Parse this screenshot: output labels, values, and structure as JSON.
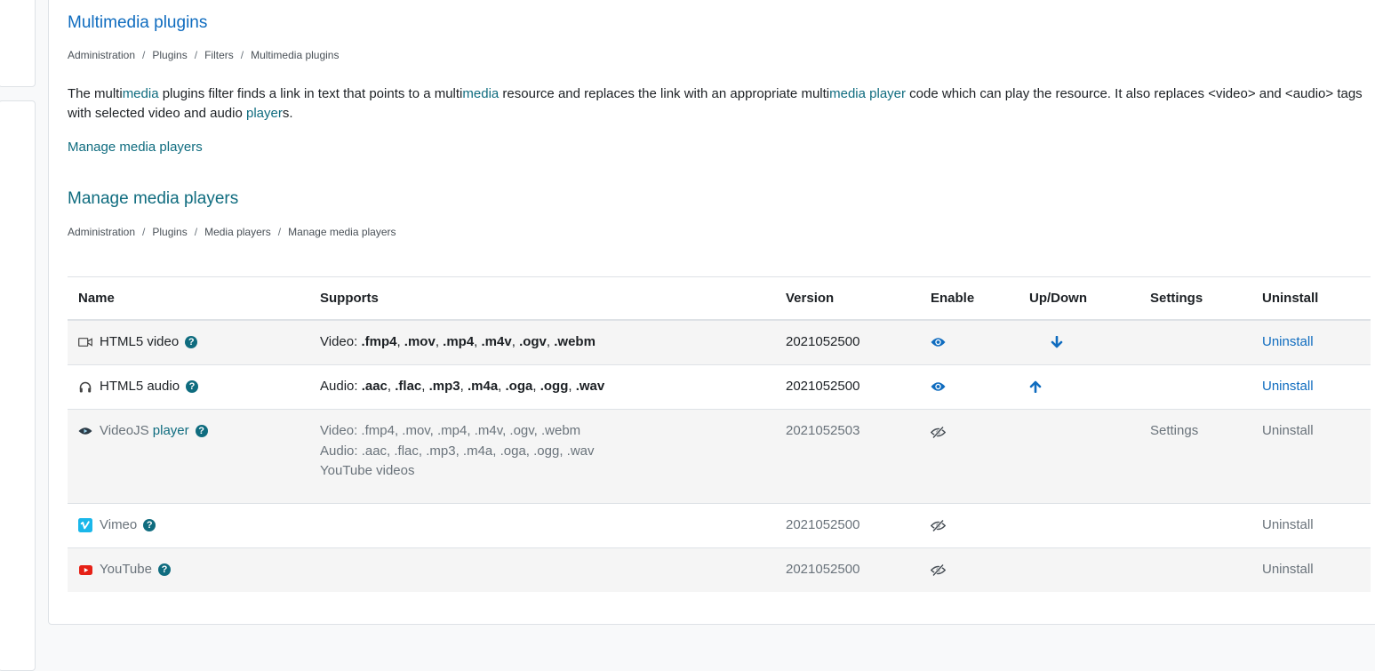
{
  "filter_section": {
    "title": "Multimedia plugins",
    "breadcrumb": [
      "Administration",
      "Plugins",
      "Filters",
      "Multimedia plugins"
    ],
    "description_parts": [
      {
        "t": "The multi",
        "hl": false
      },
      {
        "t": "media",
        "hl": true
      },
      {
        "t": " plugins filter finds a link in text that points to a multi",
        "hl": false
      },
      {
        "t": "media",
        "hl": true
      },
      {
        "t": " resource and replaces the link with an appropriate multi",
        "hl": false
      },
      {
        "t": "media player",
        "hl": true
      },
      {
        "t": " code which can play the resource. It also replaces <video> and <audio> tags with selected video and audio ",
        "hl": false
      },
      {
        "t": "player",
        "hl": true
      },
      {
        "t": "s.",
        "hl": false
      }
    ],
    "manage_link": "Manage media players"
  },
  "players_section": {
    "title": "Manage media players",
    "breadcrumb": [
      "Administration",
      "Plugins",
      "Media players",
      "Manage media players"
    ]
  },
  "table": {
    "headers": {
      "name": "Name",
      "supports": "Supports",
      "version": "Version",
      "enable": "Enable",
      "updown": "Up/Down",
      "settings": "Settings",
      "uninstall": "Uninstall"
    },
    "rows": [
      {
        "name": "HTML5 video",
        "icon": "video-camera-icon",
        "enabled": true,
        "supports": [
          {
            "label": "Video: ",
            "exts": [
              ".fmp4",
              ".mov",
              ".mp4",
              ".m4v",
              ".ogv",
              ".webm"
            ]
          }
        ],
        "version": "2021052500",
        "updown": "down-arrow-icon",
        "settings": "",
        "uninstall": "Uninstall"
      },
      {
        "name": "HTML5 audio",
        "icon": "headphones-icon",
        "enabled": true,
        "supports": [
          {
            "label": "Audio: ",
            "exts": [
              ".aac",
              ".flac",
              ".mp3",
              ".m4a",
              ".oga",
              ".ogg",
              ".wav"
            ]
          }
        ],
        "version": "2021052500",
        "updown": "up-arrow-icon",
        "settings": "",
        "uninstall": "Uninstall"
      },
      {
        "name_prefix": "VideoJS ",
        "name_link": "player",
        "icon": "videojs-icon",
        "enabled": false,
        "supports_lines": [
          "Video: .fmp4, .mov, .mp4, .m4v, .ogv, .webm",
          "Audio: .aac, .flac, .mp3, .m4a, .oga, .ogg, .wav",
          "YouTube videos"
        ],
        "version": "2021052503",
        "updown": "",
        "settings": "Settings",
        "uninstall": "Uninstall"
      },
      {
        "name": "Vimeo",
        "icon": "vimeo-icon",
        "enabled": false,
        "version": "2021052500",
        "updown": "",
        "settings": "",
        "uninstall": "Uninstall"
      },
      {
        "name": "YouTube",
        "icon": "youtube-icon",
        "enabled": false,
        "version": "2021052500",
        "updown": "",
        "settings": "",
        "uninstall": "Uninstall"
      }
    ]
  },
  "colors": {
    "link_blue": "#0f6cbf",
    "teal": "#0f6c7f",
    "vimeo": "#1ab7ea",
    "youtube": "#e62117"
  }
}
